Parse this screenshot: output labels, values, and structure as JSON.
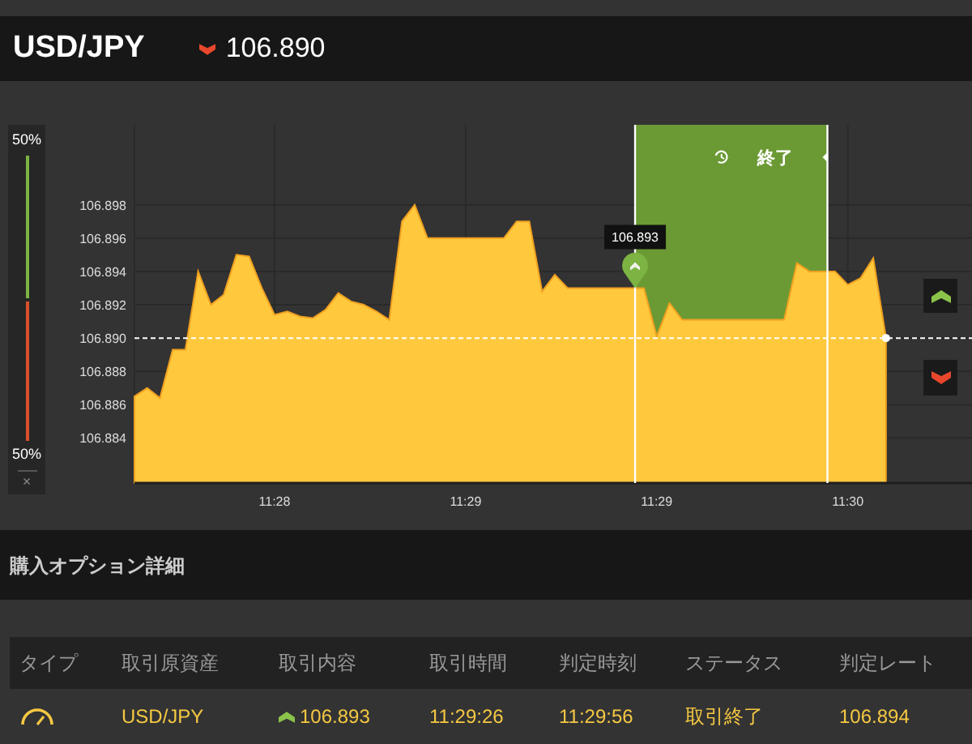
{
  "header": {
    "symbol": "USD/JPY",
    "up": false,
    "price": "106.890"
  },
  "sentiment": {
    "up_label": "50%",
    "down_label": "50%",
    "level": 0.5,
    "close": "×"
  },
  "chart": {
    "chart_data": {
      "type": "area",
      "categories": [
        null,
        null,
        null,
        null,
        null,
        null,
        null,
        null,
        null,
        null,
        null,
        "11:28",
        null,
        null,
        null,
        null,
        null,
        null,
        null,
        null,
        null,
        null,
        null,
        null,
        null,
        null,
        "11:29",
        null,
        null,
        null,
        null,
        null,
        null,
        null,
        null,
        null,
        null,
        null,
        null,
        null,
        null,
        "11:29",
        null,
        null,
        null,
        null,
        null,
        null,
        null,
        null,
        null,
        null,
        null,
        null,
        null,
        null,
        "11:30",
        null,
        null,
        null,
        null,
        null,
        null,
        null,
        null,
        null
      ],
      "series": [
        {
          "color": "#ffc83d",
          "values": [
            106.8865,
            106.887,
            106.8864,
            106.8893,
            106.8893,
            106.894,
            106.892,
            106.8926,
            106.895,
            106.8949,
            106.893,
            106.8914,
            106.8916,
            106.8913,
            106.8912,
            106.8917,
            106.8927,
            106.8922,
            106.892,
            106.8916,
            106.8911,
            106.897,
            106.898,
            106.896,
            106.896,
            106.896,
            106.896,
            106.896,
            106.896,
            106.896,
            106.897,
            106.897,
            106.8928,
            106.8938,
            106.893,
            106.893,
            106.893,
            106.893,
            106.893,
            106.893,
            106.893,
            106.8901,
            106.8921,
            106.8911,
            106.8911,
            106.8911,
            106.8911,
            106.8911,
            106.8911,
            106.8911,
            106.8911,
            106.8911,
            106.8945,
            106.894,
            106.894,
            106.894,
            106.8932,
            106.8936,
            106.8948,
            106.89,
            null,
            null,
            null,
            null,
            null,
            null
          ]
        }
      ],
      "grid": true,
      "ref_lines": [
        {
          "axis": "y",
          "value": 106.89
        }
      ],
      "ylim": [
        106.8813,
        106.9028
      ],
      "yticks": [
        {
          "value": 106.884,
          "label": "106.884"
        },
        {
          "value": 106.886,
          "label": "106.886"
        },
        {
          "value": 106.888,
          "label": "106.888"
        },
        {
          "value": 106.89,
          "label": "106.890"
        },
        {
          "value": 106.892,
          "label": "106.892"
        },
        {
          "value": 106.894,
          "label": "106.894"
        },
        {
          "value": 106.896,
          "label": "106.896"
        },
        {
          "value": 106.898,
          "label": "106.898"
        }
      ],
      "annotations": [
        "終了",
        "106.893"
      ]
    }
  },
  "details": {
    "title": "購入オプション詳細",
    "columns": [
      "タイプ",
      "取引原資産",
      "取引内容",
      "取引時間",
      "判定時刻",
      "ステータス",
      "判定レート"
    ],
    "rows": [
      {
        "asset": "USD/JPY",
        "up": true,
        "rate": "106.893",
        "trade_time": "11:29:26",
        "judge_time": "11:29:56",
        "status": "取引終了",
        "judge_rate": "106.894"
      }
    ]
  }
}
